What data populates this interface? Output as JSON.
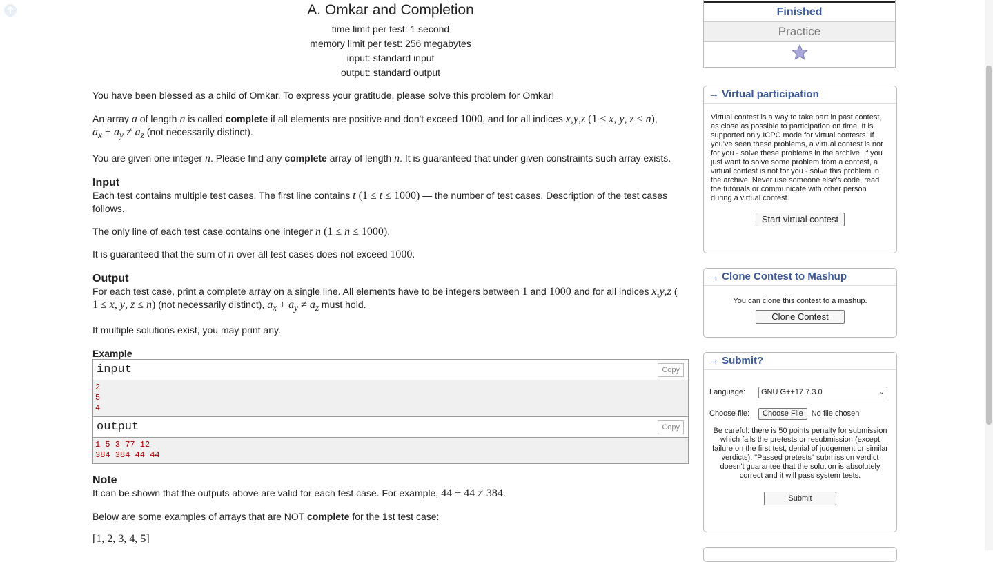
{
  "problem": {
    "title": "A. Omkar and Completion",
    "time_limit": "time limit per test: 1 second",
    "memory_limit": "memory limit per test: 256 megabytes",
    "input_file": "input: standard input",
    "output_file": "output: standard output"
  },
  "statement": {
    "p1": "You have been blessed as a child of Omkar. To express your gratitude, please solve this problem for Omkar!",
    "p2_a": "An array ",
    "p2_b": " of length ",
    "p2_c": " is called ",
    "p2_bold": "complete",
    "p2_d": " if all elements are positive and don't exceed ",
    "p2_e": ", and for all indices ",
    "p2_f": " (not necessarily distinct).",
    "p3_a": "You are given one integer ",
    "p3_b": ". Please find any ",
    "p3_bold": "complete",
    "p3_c": " array of length ",
    "p3_d": ". It is guaranteed that under given constraints such array exists."
  },
  "input_section": {
    "heading": "Input",
    "p1_a": "Each test contains multiple test cases. The first line contains ",
    "p1_b": " — the number of test cases. Description of the test cases follows.",
    "p2_a": "The only line of each test case contains one integer ",
    "p3_a": "It is guaranteed that the sum of ",
    "p3_b": " over all test cases does not exceed "
  },
  "output_section": {
    "heading": "Output",
    "p1_a": "For each test case, print a complete array on a single line. All elements have to be integers between ",
    "p1_b": " and ",
    "p1_c": " and for all indices ",
    "p1_d": " (not necessarily distinct), ",
    "p1_e": " must hold.",
    "p2": "If multiple solutions exist, you may print any."
  },
  "example": {
    "title": "Example",
    "input_label": "input",
    "output_label": "output",
    "copy_label": "Copy",
    "input_lines": [
      "2",
      "5",
      "4"
    ],
    "output_lines": [
      "1 5 3 77 12",
      "384 384 44 44"
    ]
  },
  "note": {
    "heading": "Note",
    "p1": "It can be shown that the outputs above are valid for each test case. For example, ",
    "p2_a": "Below are some examples of arrays that are NOT ",
    "p2_bold": "complete",
    "p2_b": " for the 1st test case:",
    "example_array": "[1, 2, 3, 4, 5]"
  },
  "sidebar": {
    "status_finished": "Finished",
    "status_practice": "Practice",
    "virtual": {
      "title": "→ Virtual participation",
      "text": "Virtual contest is a way to take part in past contest, as close as possible to participation on time. It is supported only ICPC mode for virtual contests. If you've seen these problems, a virtual contest is not for you - solve these problems in the archive. If you just want to solve some problem from a contest, a virtual contest is not for you - solve this problem in the archive. Never use someone else's code, read the tutorials or communicate with other person during a virtual contest.",
      "button": "Start virtual contest"
    },
    "clone": {
      "title": "→ Clone Contest to Mashup",
      "text": "You can clone this contest to a mashup.",
      "button": "Clone Contest"
    },
    "submit": {
      "title": "→ Submit?",
      "language_label": "Language:",
      "language_value": "GNU G++17 7.3.0",
      "file_label": "Choose file:",
      "file_button": "Choose File",
      "file_status": "No file chosen",
      "warning": "Be careful: there is 50 points penalty for submission which fails the pretests or resubmission (except failure on the first test, denial of judgement or similar verdicts). \"Passed pretests\" submission verdict doesn't guarantee that the solution is absolutely correct and it will pass system tests.",
      "button": "Submit"
    }
  },
  "colors": {
    "accent": "#3b5998",
    "sample": "#aa0000"
  }
}
